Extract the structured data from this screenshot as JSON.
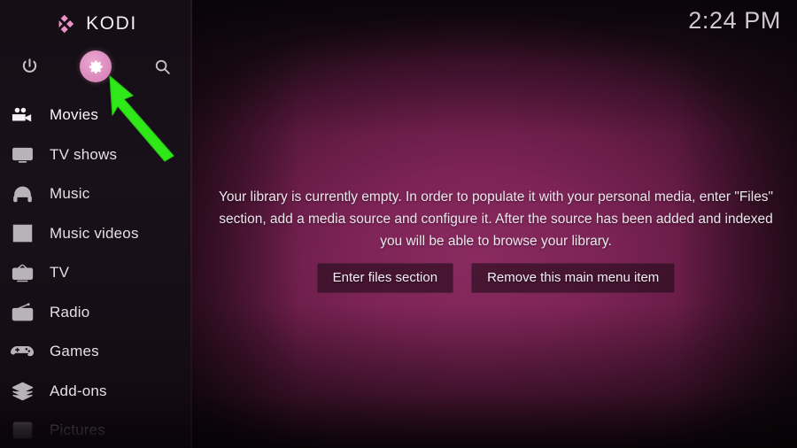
{
  "app": {
    "name": "KODI",
    "logo_icon": "kodi-logo-icon",
    "accent_pink": "#dd8ec0",
    "background_magenta": "#7d2456",
    "sidebar_background": "#17101a"
  },
  "clock": {
    "time": "2:24 PM"
  },
  "top_icons": [
    {
      "name": "power-icon",
      "label": "Power"
    },
    {
      "name": "settings-gear-icon",
      "label": "Settings",
      "highlighted": true
    },
    {
      "name": "search-icon",
      "label": "Search"
    }
  ],
  "sidebar": {
    "items": [
      {
        "label": "Movies",
        "icon": "movie-camera-icon",
        "state": "selected"
      },
      {
        "label": "TV shows",
        "icon": "tv-monitor-icon",
        "state": "normal"
      },
      {
        "label": "Music",
        "icon": "headphones-icon",
        "state": "normal"
      },
      {
        "label": "Music videos",
        "icon": "music-video-icon",
        "state": "normal"
      },
      {
        "label": "TV",
        "icon": "retro-tv-icon",
        "state": "normal"
      },
      {
        "label": "Radio",
        "icon": "radio-icon",
        "state": "normal"
      },
      {
        "label": "Games",
        "icon": "gamepad-icon",
        "state": "normal"
      },
      {
        "label": "Add-ons",
        "icon": "addons-box-icon",
        "state": "normal"
      },
      {
        "label": "Pictures",
        "icon": "pictures-icon",
        "state": "dim"
      }
    ]
  },
  "main": {
    "empty_message": "Your library is currently empty. In order to populate it with your personal media, enter \"Files\" section, add a media source and configure it. After the source has been added and indexed you will be able to browse your library.",
    "buttons": [
      {
        "label": "Enter files section"
      },
      {
        "label": "Remove this main menu item"
      }
    ]
  },
  "annotation": {
    "arrow_color": "#2fe818",
    "points_to": "settings-gear-icon"
  }
}
